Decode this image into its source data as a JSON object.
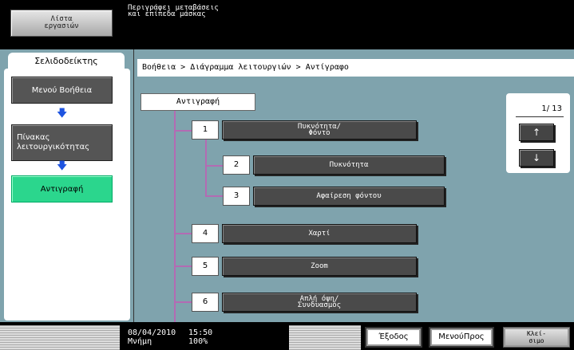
{
  "top": {
    "job_list_line1": "Λίστα",
    "job_list_line2": "εργασιών",
    "message_line1": "Περιγράφει μεταβάσεις",
    "message_line2": "και επίπεδα μάσκας"
  },
  "sidebar": {
    "tab_label": "Σελιδοδείκτης",
    "help_menu": "Μενού Βοήθεια",
    "func_table_line1": "Πίνακας",
    "func_table_line2": "λειτουργικότητας",
    "copy": "Αντιγραφή",
    "arrow": "🡇"
  },
  "main": {
    "breadcrumb": "Βοήθεια > Διάγραμμα λειτουργιών > Αντίγραφο",
    "root": "Αντιγραφή",
    "items": [
      {
        "num": "1",
        "label_line1": "Πυκνότητα/",
        "label_line2": "Φόντο"
      },
      {
        "num": "2",
        "label_line1": "Πυκνότητα",
        "label_line2": ""
      },
      {
        "num": "3",
        "label_line1": "Αφαίρεση φόντου",
        "label_line2": ""
      },
      {
        "num": "4",
        "label_line1": "Χαρτί",
        "label_line2": ""
      },
      {
        "num": "5",
        "label_line1": "Zoom",
        "label_line2": ""
      },
      {
        "num": "6",
        "label_line1": "Απλή όψη/",
        "label_line2": "Συνδυασμός"
      }
    ],
    "page_indicator": "1/ 13",
    "page_up": "↑",
    "page_down": "↓"
  },
  "bottom": {
    "date": "08/04/2010",
    "time": "15:50",
    "memory_label": "Μνήμη",
    "memory_value": "100%",
    "exit": "Έξοδος",
    "menu_prev": "ΜενούΠρος",
    "close_line1": "Κλεί-",
    "close_line2": "σιμο"
  }
}
